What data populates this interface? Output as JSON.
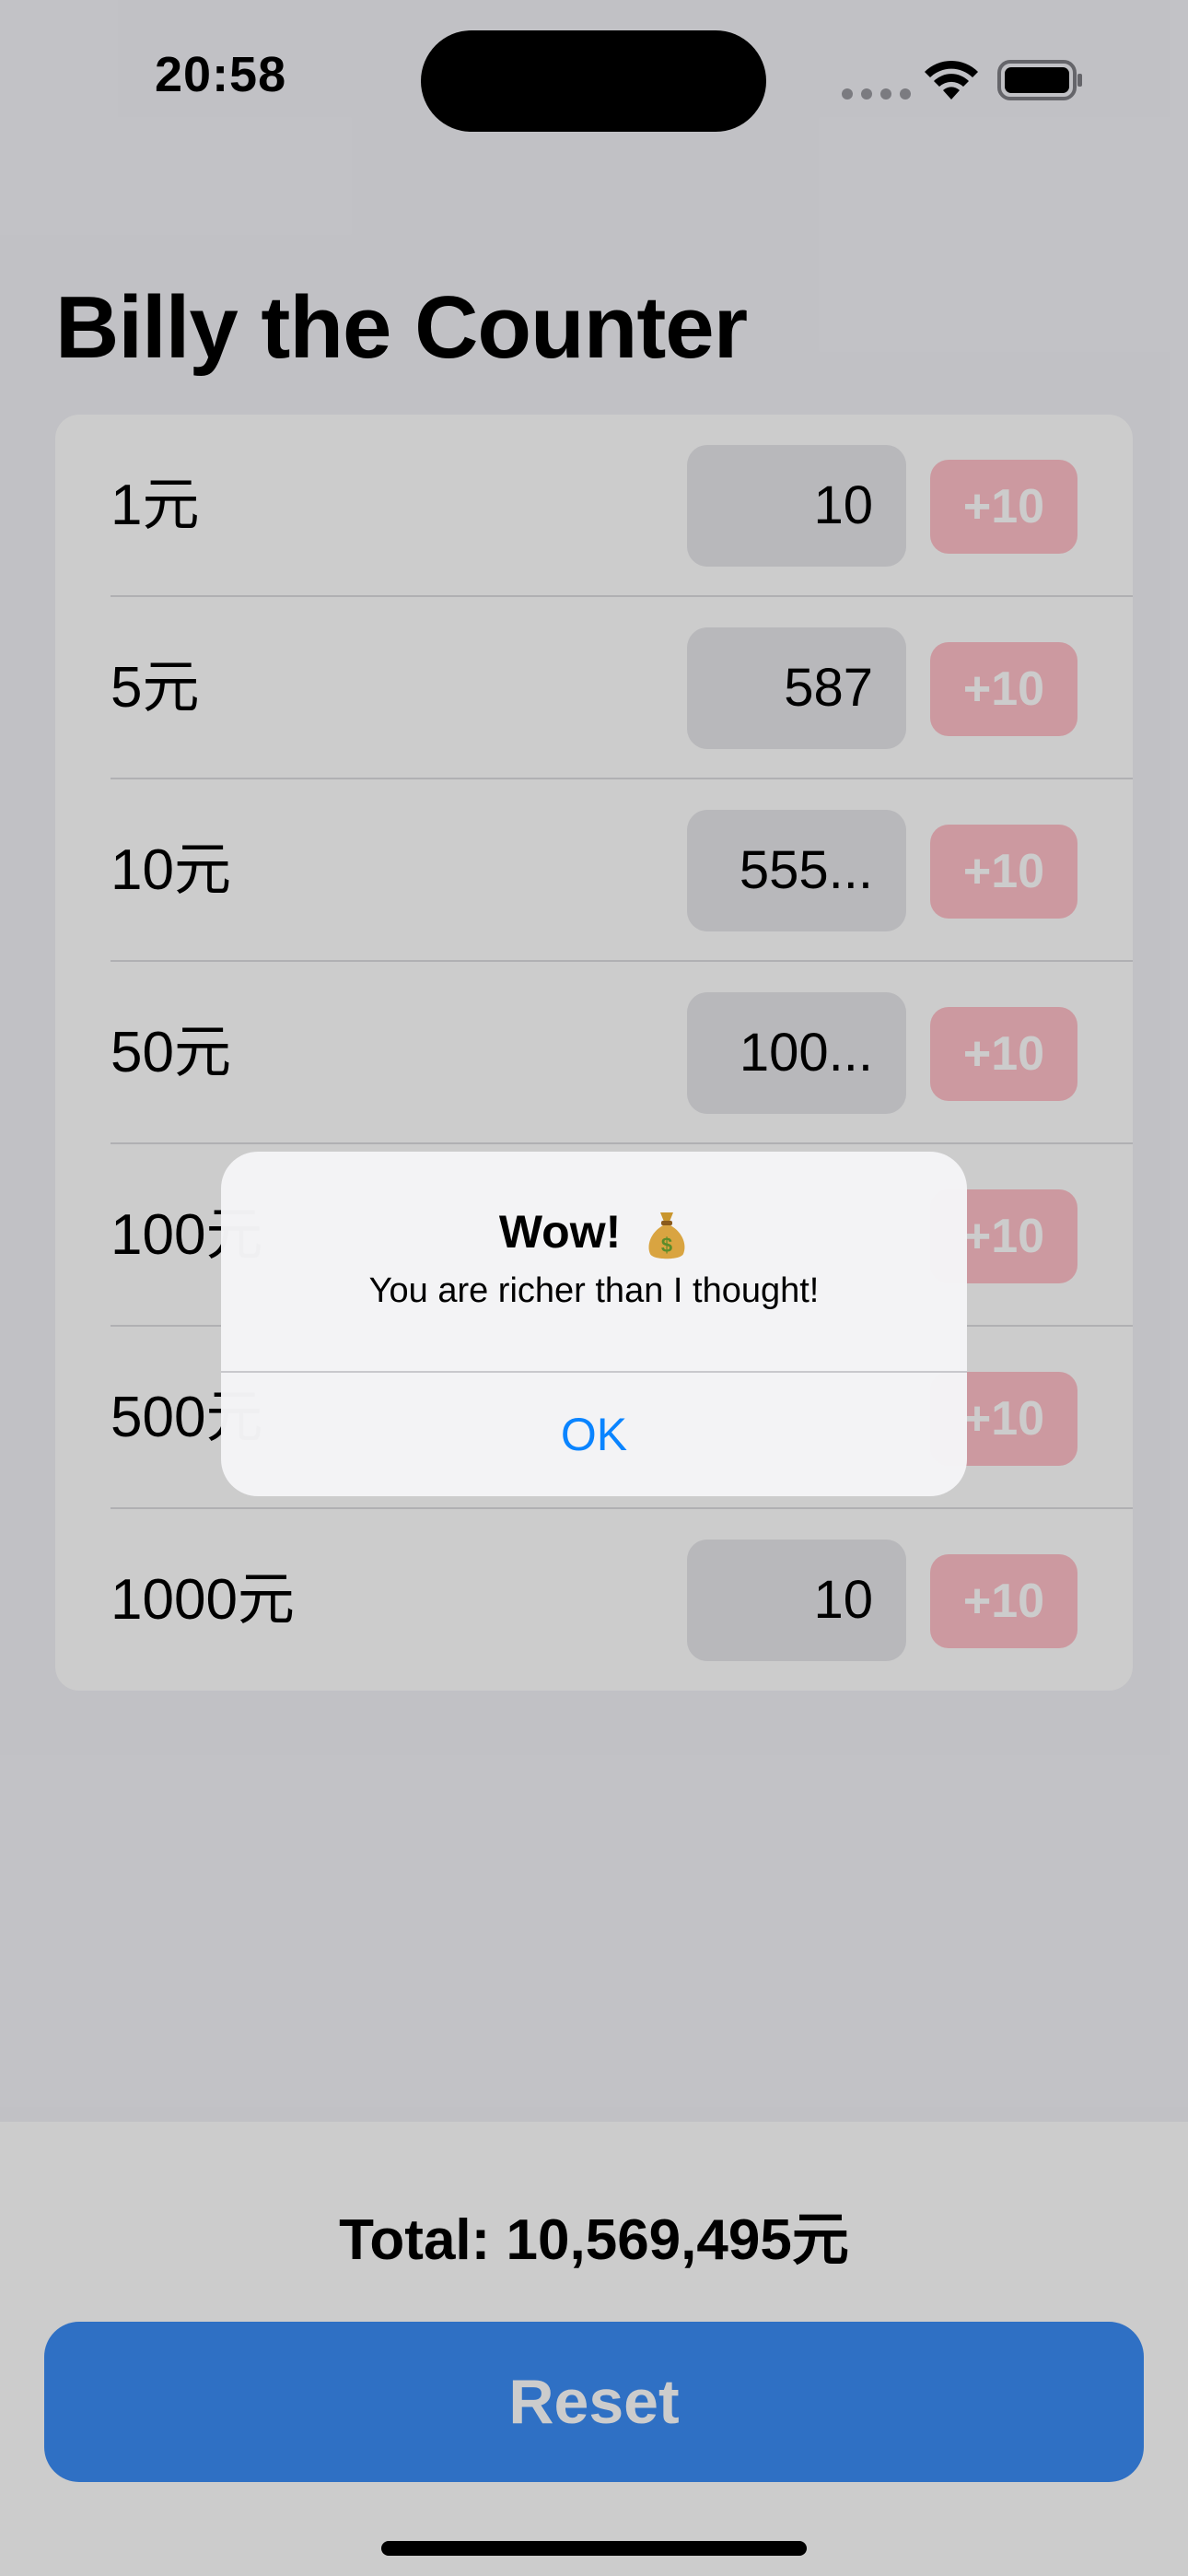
{
  "status_bar": {
    "time": "20:58"
  },
  "nav": {
    "title": "Billy the Counter"
  },
  "denominations": [
    {
      "label": "1元",
      "count": "10",
      "button": "+10"
    },
    {
      "label": "5元",
      "count": "587",
      "button": "+10"
    },
    {
      "label": "10元",
      "count": "555...",
      "button": "+10"
    },
    {
      "label": "50元",
      "count": "100...",
      "button": "+10"
    },
    {
      "label": "100元",
      "count": "",
      "button": "+10"
    },
    {
      "label": "500元",
      "count": "",
      "button": "+10"
    },
    {
      "label": "1000元",
      "count": "10",
      "button": "+10"
    }
  ],
  "footer": {
    "total": "Total: 10,569,495元",
    "reset_label": "Reset"
  },
  "alert": {
    "title": "Wow!",
    "icon": "money-bag-icon",
    "message": "You are richer than I thought!",
    "ok_label": "OK"
  },
  "colors": {
    "accent_blue": "#3b8cf5",
    "plus_button_pink": "#ffc0c8",
    "alert_button_blue": "#0a84ff"
  }
}
